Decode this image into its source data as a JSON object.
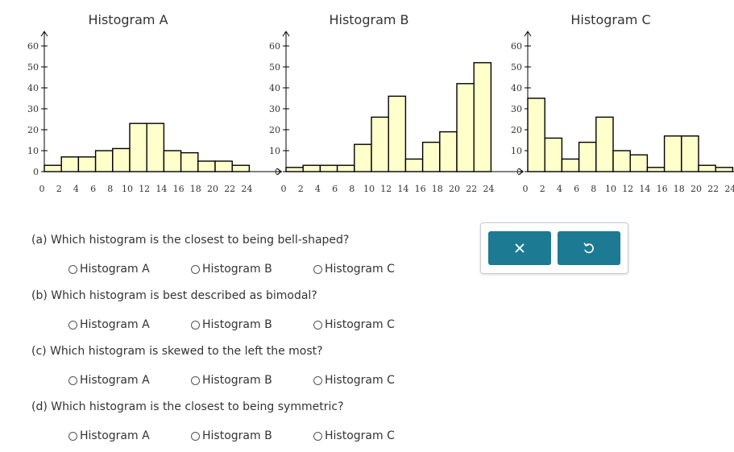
{
  "chart_data": [
    {
      "type": "bar",
      "title": "Histogram A",
      "bin_start": 0,
      "bin_width": 2,
      "values": [
        3,
        7,
        7,
        10,
        11,
        23,
        23,
        10,
        9,
        5,
        5,
        3
      ],
      "x_tick_labels": [
        "0",
        "2",
        "4",
        "6",
        "8",
        "10",
        "12",
        "14",
        "16",
        "18",
        "20",
        "22",
        "24"
      ],
      "y_tick_labels": [
        "0",
        "10",
        "20",
        "30",
        "40",
        "50",
        "60"
      ],
      "ylim": [
        0,
        60
      ],
      "xlim": [
        0,
        24
      ],
      "grid": false,
      "bar_fill": "#ffffcc",
      "bar_stroke": "#000000"
    },
    {
      "type": "bar",
      "title": "Histogram B",
      "bin_start": 0,
      "bin_width": 2,
      "values": [
        2,
        3,
        3,
        3,
        13,
        26,
        36,
        6,
        14,
        19,
        42,
        52
      ],
      "x_tick_labels": [
        "0",
        "2",
        "4",
        "6",
        "8",
        "10",
        "12",
        "14",
        "16",
        "18",
        "20",
        "22",
        "24"
      ],
      "y_tick_labels": [
        "0",
        "10",
        "20",
        "30",
        "40",
        "50",
        "60"
      ],
      "ylim": [
        0,
        60
      ],
      "xlim": [
        0,
        24
      ],
      "grid": false,
      "bar_fill": "#ffffcc",
      "bar_stroke": "#000000"
    },
    {
      "type": "bar",
      "title": "Histogram C",
      "bin_start": 0,
      "bin_width": 2,
      "values": [
        35,
        16,
        6,
        14,
        26,
        10,
        8,
        2,
        17,
        17,
        3,
        2
      ],
      "x_tick_labels": [
        "0",
        "2",
        "4",
        "6",
        "8",
        "10",
        "12",
        "14",
        "16",
        "18",
        "20",
        "22",
        "24"
      ],
      "y_tick_labels": [
        "0",
        "10",
        "20",
        "30",
        "40",
        "50",
        "60"
      ],
      "ylim": [
        0,
        60
      ],
      "xlim": [
        0,
        24
      ],
      "grid": false,
      "bar_fill": "#ffffcc",
      "bar_stroke": "#000000"
    }
  ],
  "questions": [
    {
      "text": "(a) Which histogram is the closest to being bell-shaped?",
      "options": [
        "Histogram A",
        "Histogram B",
        "Histogram C"
      ]
    },
    {
      "text": "(b) Which histogram is best described as bimodal?",
      "options": [
        "Histogram A",
        "Histogram B",
        "Histogram C"
      ]
    },
    {
      "text": "(c) Which histogram is skewed to the left the most?",
      "options": [
        "Histogram A",
        "Histogram B",
        "Histogram C"
      ]
    },
    {
      "text": "(d) Which histogram is the closest to being symmetric?",
      "options": [
        "Histogram A",
        "Histogram B",
        "Histogram C"
      ]
    }
  ],
  "tools": {
    "clear_icon": "close-icon",
    "undo_icon": "undo-icon",
    "button_color": "#1c7a93"
  }
}
